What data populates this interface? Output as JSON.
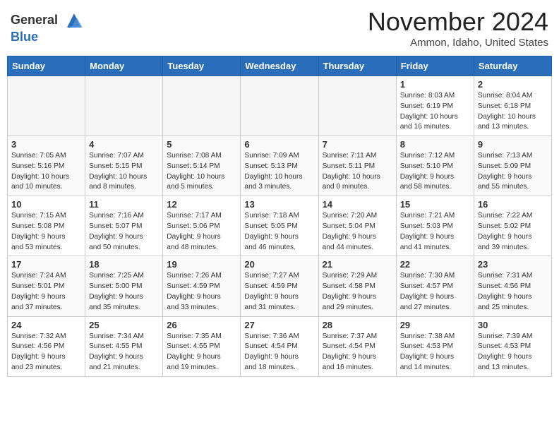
{
  "header": {
    "logo_line1": "General",
    "logo_line2": "Blue",
    "month": "November 2024",
    "location": "Ammon, Idaho, United States"
  },
  "weekdays": [
    "Sunday",
    "Monday",
    "Tuesday",
    "Wednesday",
    "Thursday",
    "Friday",
    "Saturday"
  ],
  "weeks": [
    [
      {
        "day": "",
        "info": ""
      },
      {
        "day": "",
        "info": ""
      },
      {
        "day": "",
        "info": ""
      },
      {
        "day": "",
        "info": ""
      },
      {
        "day": "",
        "info": ""
      },
      {
        "day": "1",
        "info": "Sunrise: 8:03 AM\nSunset: 6:19 PM\nDaylight: 10 hours\nand 16 minutes."
      },
      {
        "day": "2",
        "info": "Sunrise: 8:04 AM\nSunset: 6:18 PM\nDaylight: 10 hours\nand 13 minutes."
      }
    ],
    [
      {
        "day": "3",
        "info": "Sunrise: 7:05 AM\nSunset: 5:16 PM\nDaylight: 10 hours\nand 10 minutes."
      },
      {
        "day": "4",
        "info": "Sunrise: 7:07 AM\nSunset: 5:15 PM\nDaylight: 10 hours\nand 8 minutes."
      },
      {
        "day": "5",
        "info": "Sunrise: 7:08 AM\nSunset: 5:14 PM\nDaylight: 10 hours\nand 5 minutes."
      },
      {
        "day": "6",
        "info": "Sunrise: 7:09 AM\nSunset: 5:13 PM\nDaylight: 10 hours\nand 3 minutes."
      },
      {
        "day": "7",
        "info": "Sunrise: 7:11 AM\nSunset: 5:11 PM\nDaylight: 10 hours\nand 0 minutes."
      },
      {
        "day": "8",
        "info": "Sunrise: 7:12 AM\nSunset: 5:10 PM\nDaylight: 9 hours\nand 58 minutes."
      },
      {
        "day": "9",
        "info": "Sunrise: 7:13 AM\nSunset: 5:09 PM\nDaylight: 9 hours\nand 55 minutes."
      }
    ],
    [
      {
        "day": "10",
        "info": "Sunrise: 7:15 AM\nSunset: 5:08 PM\nDaylight: 9 hours\nand 53 minutes."
      },
      {
        "day": "11",
        "info": "Sunrise: 7:16 AM\nSunset: 5:07 PM\nDaylight: 9 hours\nand 50 minutes."
      },
      {
        "day": "12",
        "info": "Sunrise: 7:17 AM\nSunset: 5:06 PM\nDaylight: 9 hours\nand 48 minutes."
      },
      {
        "day": "13",
        "info": "Sunrise: 7:18 AM\nSunset: 5:05 PM\nDaylight: 9 hours\nand 46 minutes."
      },
      {
        "day": "14",
        "info": "Sunrise: 7:20 AM\nSunset: 5:04 PM\nDaylight: 9 hours\nand 44 minutes."
      },
      {
        "day": "15",
        "info": "Sunrise: 7:21 AM\nSunset: 5:03 PM\nDaylight: 9 hours\nand 41 minutes."
      },
      {
        "day": "16",
        "info": "Sunrise: 7:22 AM\nSunset: 5:02 PM\nDaylight: 9 hours\nand 39 minutes."
      }
    ],
    [
      {
        "day": "17",
        "info": "Sunrise: 7:24 AM\nSunset: 5:01 PM\nDaylight: 9 hours\nand 37 minutes."
      },
      {
        "day": "18",
        "info": "Sunrise: 7:25 AM\nSunset: 5:00 PM\nDaylight: 9 hours\nand 35 minutes."
      },
      {
        "day": "19",
        "info": "Sunrise: 7:26 AM\nSunset: 4:59 PM\nDaylight: 9 hours\nand 33 minutes."
      },
      {
        "day": "20",
        "info": "Sunrise: 7:27 AM\nSunset: 4:59 PM\nDaylight: 9 hours\nand 31 minutes."
      },
      {
        "day": "21",
        "info": "Sunrise: 7:29 AM\nSunset: 4:58 PM\nDaylight: 9 hours\nand 29 minutes."
      },
      {
        "day": "22",
        "info": "Sunrise: 7:30 AM\nSunset: 4:57 PM\nDaylight: 9 hours\nand 27 minutes."
      },
      {
        "day": "23",
        "info": "Sunrise: 7:31 AM\nSunset: 4:56 PM\nDaylight: 9 hours\nand 25 minutes."
      }
    ],
    [
      {
        "day": "24",
        "info": "Sunrise: 7:32 AM\nSunset: 4:56 PM\nDaylight: 9 hours\nand 23 minutes."
      },
      {
        "day": "25",
        "info": "Sunrise: 7:34 AM\nSunset: 4:55 PM\nDaylight: 9 hours\nand 21 minutes."
      },
      {
        "day": "26",
        "info": "Sunrise: 7:35 AM\nSunset: 4:55 PM\nDaylight: 9 hours\nand 19 minutes."
      },
      {
        "day": "27",
        "info": "Sunrise: 7:36 AM\nSunset: 4:54 PM\nDaylight: 9 hours\nand 18 minutes."
      },
      {
        "day": "28",
        "info": "Sunrise: 7:37 AM\nSunset: 4:54 PM\nDaylight: 9 hours\nand 16 minutes."
      },
      {
        "day": "29",
        "info": "Sunrise: 7:38 AM\nSunset: 4:53 PM\nDaylight: 9 hours\nand 14 minutes."
      },
      {
        "day": "30",
        "info": "Sunrise: 7:39 AM\nSunset: 4:53 PM\nDaylight: 9 hours\nand 13 minutes."
      }
    ]
  ]
}
